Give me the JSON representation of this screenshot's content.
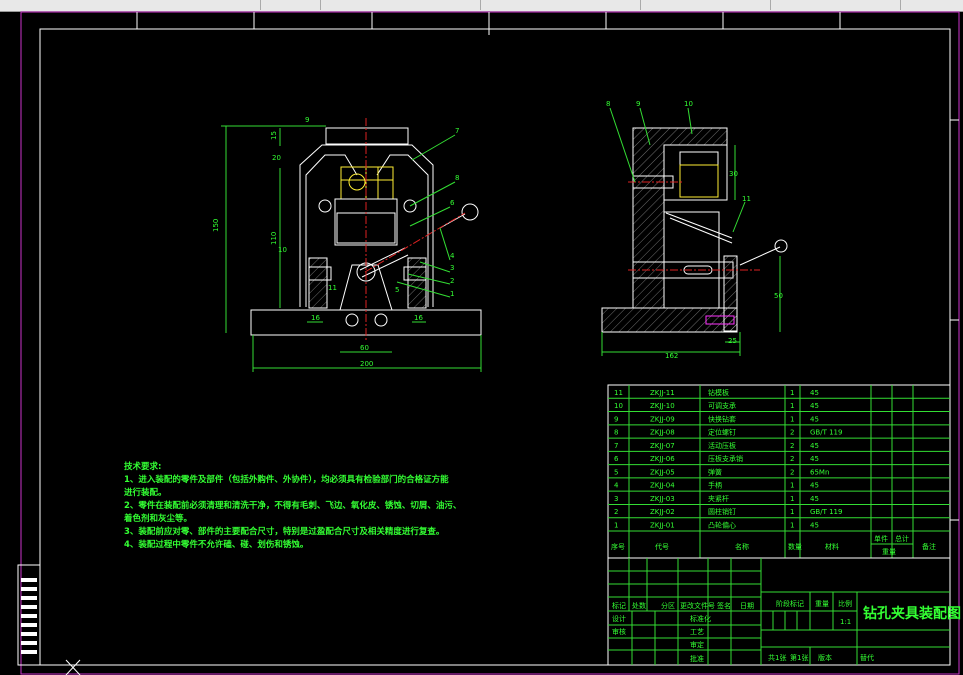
{
  "window": {
    "background": "#000000",
    "line_color": "#33dd33",
    "outline_color": "#ffffff"
  },
  "notes": {
    "heading": "技术要求:",
    "lines": [
      "1、进入装配的零件及部件（包括外购件、外协件），均必须具有检验部门的合格证方能",
      "进行装配。",
      "2、零件在装配前必须清理和清洗干净，不得有毛刺、飞边、氧化皮、锈蚀、切屑、油污、",
      "着色剂和灰尘等。",
      "3、装配前应对零、部件的主要配合尺寸，特别是过盈配合尺寸及相关精度进行复查。",
      "4、装配过程中零件不允许磕、碰、划伤和锈蚀。"
    ]
  },
  "parts": [
    {
      "no": "11",
      "code": "ZKJJ-11",
      "name": "钻模板",
      "qty": "1",
      "material": "45"
    },
    {
      "no": "10",
      "code": "ZKJJ-10",
      "name": "可调支承",
      "qty": "1",
      "material": "45"
    },
    {
      "no": "9",
      "code": "ZKJJ-09",
      "name": "快换钻套",
      "qty": "1",
      "material": "45"
    },
    {
      "no": "8",
      "code": "ZKJJ-08",
      "name": "定位螺钉",
      "qty": "2",
      "material": "GB/T 119"
    },
    {
      "no": "7",
      "code": "ZKJJ-07",
      "name": "活动压板",
      "qty": "2",
      "material": "45"
    },
    {
      "no": "6",
      "code": "ZKJJ-06",
      "name": "压板支承销",
      "qty": "2",
      "material": "45"
    },
    {
      "no": "5",
      "code": "ZKJJ-05",
      "name": "弹簧",
      "qty": "2",
      "material": "65Mn"
    },
    {
      "no": "4",
      "code": "ZKJJ-04",
      "name": "手柄",
      "qty": "1",
      "material": "45"
    },
    {
      "no": "3",
      "code": "ZKJJ-03",
      "name": "夹紧杆",
      "qty": "1",
      "material": "45"
    },
    {
      "no": "2",
      "code": "ZKJJ-02",
      "name": "圆柱销钉",
      "qty": "1",
      "material": "GB/T 119"
    },
    {
      "no": "1",
      "code": "ZKJJ-01",
      "name": "凸轮偏心",
      "qty": "1",
      "material": "45"
    }
  ],
  "parts_header": {
    "no": "序号",
    "code": "代号",
    "name": "名称",
    "qty": "数量",
    "material": "材料",
    "unit": "单件",
    "total": "总计",
    "weight": "重量",
    "remark": "备注"
  },
  "title_block": {
    "mark": "标记",
    "count": "处数",
    "zone": "分区",
    "doc": "更改文件号",
    "sign": "签名",
    "date": "日期",
    "design": "设计",
    "standard": "标准化",
    "check": "审核",
    "process": "工艺",
    "review": "审定",
    "approve": "批准",
    "stage": "阶段标记",
    "weight": "重量",
    "scale": "比例",
    "scale_value": "1:1",
    "drawing_title": "钻孔夹具装配图",
    "sheets": "共1张",
    "sheet_no": "第1张",
    "version": "版本",
    "replace": "替代"
  },
  "dimensions": {
    "front_height": "150",
    "front_inner": "110",
    "front_top": "15",
    "front_gap": "20",
    "front_left": "16",
    "front_right": "16",
    "front_center": "60",
    "front_width": "200",
    "side_width": "162",
    "side_small": "25",
    "side_height": "50",
    "side_top": "30"
  },
  "balloons": {
    "front": [
      "7",
      "8",
      "6",
      "4",
      "3",
      "2",
      "1",
      "9",
      "10",
      "5",
      "11"
    ],
    "side": [
      "8",
      "9",
      "10",
      "11"
    ]
  }
}
